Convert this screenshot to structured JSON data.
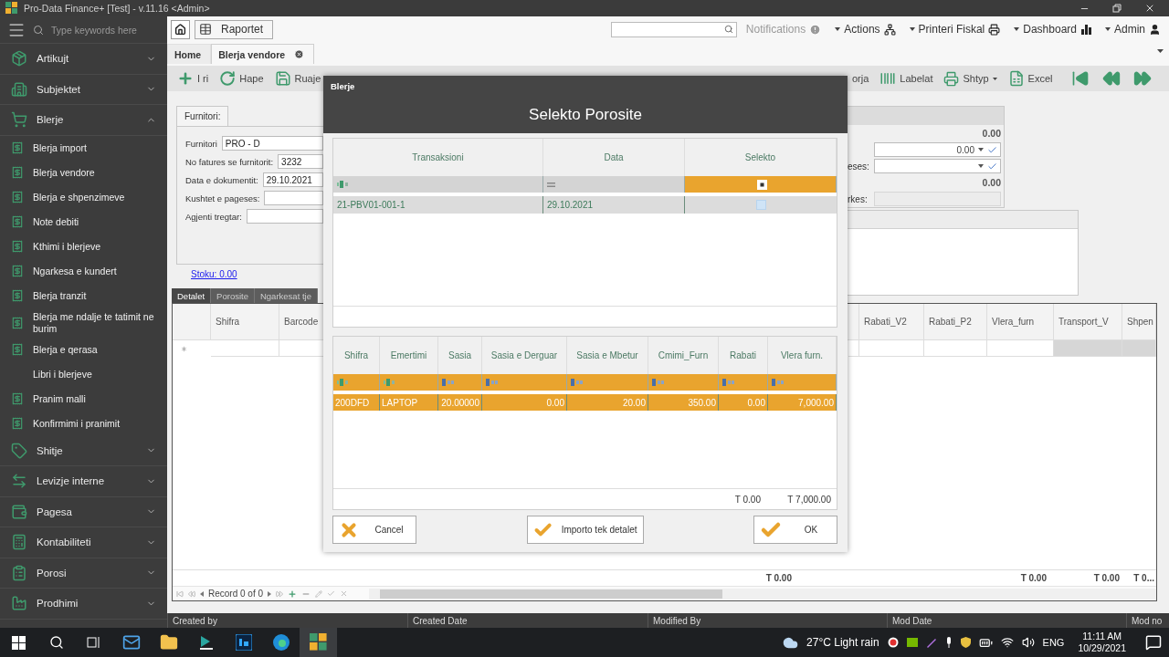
{
  "window": {
    "title": "Pro-Data Finance+ [Test] - v.11.16 <Admin>"
  },
  "sidebar": {
    "search_placeholder": "Type keywords here",
    "groups": [
      {
        "label": "Artikujt",
        "expanded": false
      },
      {
        "label": "Subjektet",
        "expanded": false
      },
      {
        "label": "Blerje",
        "expanded": true,
        "children": [
          {
            "label": "Blerja import",
            "has_icon": true
          },
          {
            "label": "Blerja vendore",
            "has_icon": true
          },
          {
            "label": "Blerja e shpenzimeve",
            "has_icon": true
          },
          {
            "label": "Note debiti",
            "has_icon": true
          },
          {
            "label": "Kthimi i blerjeve",
            "has_icon": true
          },
          {
            "label": "Ngarkesa e kundert",
            "has_icon": true
          },
          {
            "label": "Blerja tranzit",
            "has_icon": true
          },
          {
            "label": "Blerja me ndalje te tatimit ne burim",
            "has_icon": true
          },
          {
            "label": "Blerja e qerasa",
            "has_icon": true
          },
          {
            "label": "Libri i blerjeve",
            "has_icon": false
          },
          {
            "label": "Pranim malli",
            "has_icon": true
          },
          {
            "label": "Konfirmimi i pranimit",
            "has_icon": true
          }
        ]
      },
      {
        "label": "Shitje",
        "expanded": false
      },
      {
        "label": "Levizje interne",
        "expanded": false
      },
      {
        "label": "Pagesa",
        "expanded": false
      },
      {
        "label": "Kontabiliteti",
        "expanded": false
      },
      {
        "label": "Porosi",
        "expanded": false
      },
      {
        "label": "Prodhimi",
        "expanded": false
      }
    ]
  },
  "topbar": {
    "reports_button": "Raportet",
    "menus": [
      {
        "label": "Notifications",
        "dropdown": false,
        "disabled": true
      },
      {
        "label": "Actions",
        "dropdown": true,
        "disabled": false
      },
      {
        "label": "Printeri Fiskal",
        "dropdown": true,
        "disabled": false
      },
      {
        "label": "Dashboard",
        "dropdown": true,
        "disabled": false
      },
      {
        "label": "Admin",
        "dropdown": true,
        "disabled": false
      }
    ]
  },
  "tabs": [
    {
      "label": "Home",
      "selected": false,
      "closable": false
    },
    {
      "label": "Blerja vendore",
      "selected": true,
      "closable": true
    }
  ],
  "toolbar": {
    "left": [
      {
        "label": "I ri",
        "dropdown": false
      },
      {
        "label": "Hape",
        "dropdown": false
      },
      {
        "label": "Ruaje",
        "dropdown": false
      }
    ],
    "right": [
      {
        "label": "orja",
        "dropdown": false
      },
      {
        "label": "Labelat",
        "dropdown": false
      },
      {
        "label": "Shtyp",
        "dropdown": true
      },
      {
        "label": "Excel",
        "dropdown": false
      }
    ]
  },
  "form": {
    "group_title": "Furnitori:",
    "fields": [
      {
        "label": "Furnitori",
        "value": "PRO - D"
      },
      {
        "label": "No fatures se furnitorit:",
        "value": "3232"
      },
      {
        "label": "Data e dokumentit:",
        "value": "29.10.2021"
      },
      {
        "label": "Kushtet e pageses:"
      },
      {
        "label": "Agjenti tregtar:"
      }
    ],
    "stock_link": "Stoku: 0.00",
    "right_rows": [
      {
        "kind": "total",
        "value": "0.00"
      },
      {
        "kind": "combo",
        "value": "0.00"
      },
      {
        "kind": "combo",
        "label": "eses:"
      },
      {
        "kind": "total",
        "value": "0.00"
      },
      {
        "kind": "readonly",
        "label": "rkes:"
      }
    ]
  },
  "detail_tabs": [
    {
      "label": "Detalet",
      "selected": true
    },
    {
      "label": "Porosite",
      "selected": false
    },
    {
      "label": "Ngarkesat tje",
      "selected": false
    }
  ],
  "detail_grid": {
    "columns_left": [
      "Shifra",
      "Barcode"
    ],
    "columns_right": [
      "Rabati_V2",
      "Rabati_P2",
      "Vlera_furn",
      "Transport_V",
      "Shpen"
    ],
    "totals": [
      "T 0.00",
      "T 0.00",
      "T 0.00",
      "T 0..."
    ],
    "navigator": "Record 0 of 0"
  },
  "dialog": {
    "title": "Blerje",
    "heading": "Selekto Porosite",
    "orders": {
      "columns": [
        {
          "label": "Transaksioni",
          "kind": "text"
        },
        {
          "label": "Data",
          "kind": "date"
        },
        {
          "label": "Selekto",
          "kind": "check"
        }
      ],
      "rows": [
        {
          "transaction": "21-PBV01-001-1",
          "date": "29.10.2021",
          "checked": false
        }
      ]
    },
    "items": {
      "columns": [
        {
          "label": "Shifra",
          "kind": "text"
        },
        {
          "label": "Emertimi",
          "kind": "text"
        },
        {
          "label": "Sasia",
          "kind": "number"
        },
        {
          "label": "Sasia e Derguar",
          "kind": "number"
        },
        {
          "label": "Sasia e Mbetur",
          "kind": "number"
        },
        {
          "label": "Cmimi_Furn",
          "kind": "number"
        },
        {
          "label": "Rabati",
          "kind": "number"
        },
        {
          "label": "Vlera furn.",
          "kind": "number"
        }
      ],
      "rows": [
        {
          "cells": [
            "200DFD",
            "LAPTOP",
            "20.00000",
            "0.00",
            "20.00",
            "350.00",
            "0.00",
            "7,000.00"
          ],
          "selected": true
        }
      ],
      "totals": [
        "T 0.00",
        "T 7,000.00"
      ]
    },
    "buttons": [
      {
        "label": "Cancel",
        "kind": "cancel"
      },
      {
        "label": "Importo tek detalet",
        "kind": "confirm"
      },
      {
        "label": "OK",
        "kind": "confirm"
      }
    ]
  },
  "status_bar": [
    "Created by",
    "Created Date",
    "Modified By",
    "Mod Date",
    "Mod no"
  ],
  "taskbar": {
    "weather": "27°C Light rain",
    "language": "ENG",
    "time": "11:11 AM",
    "date": "10/29/2021"
  }
}
